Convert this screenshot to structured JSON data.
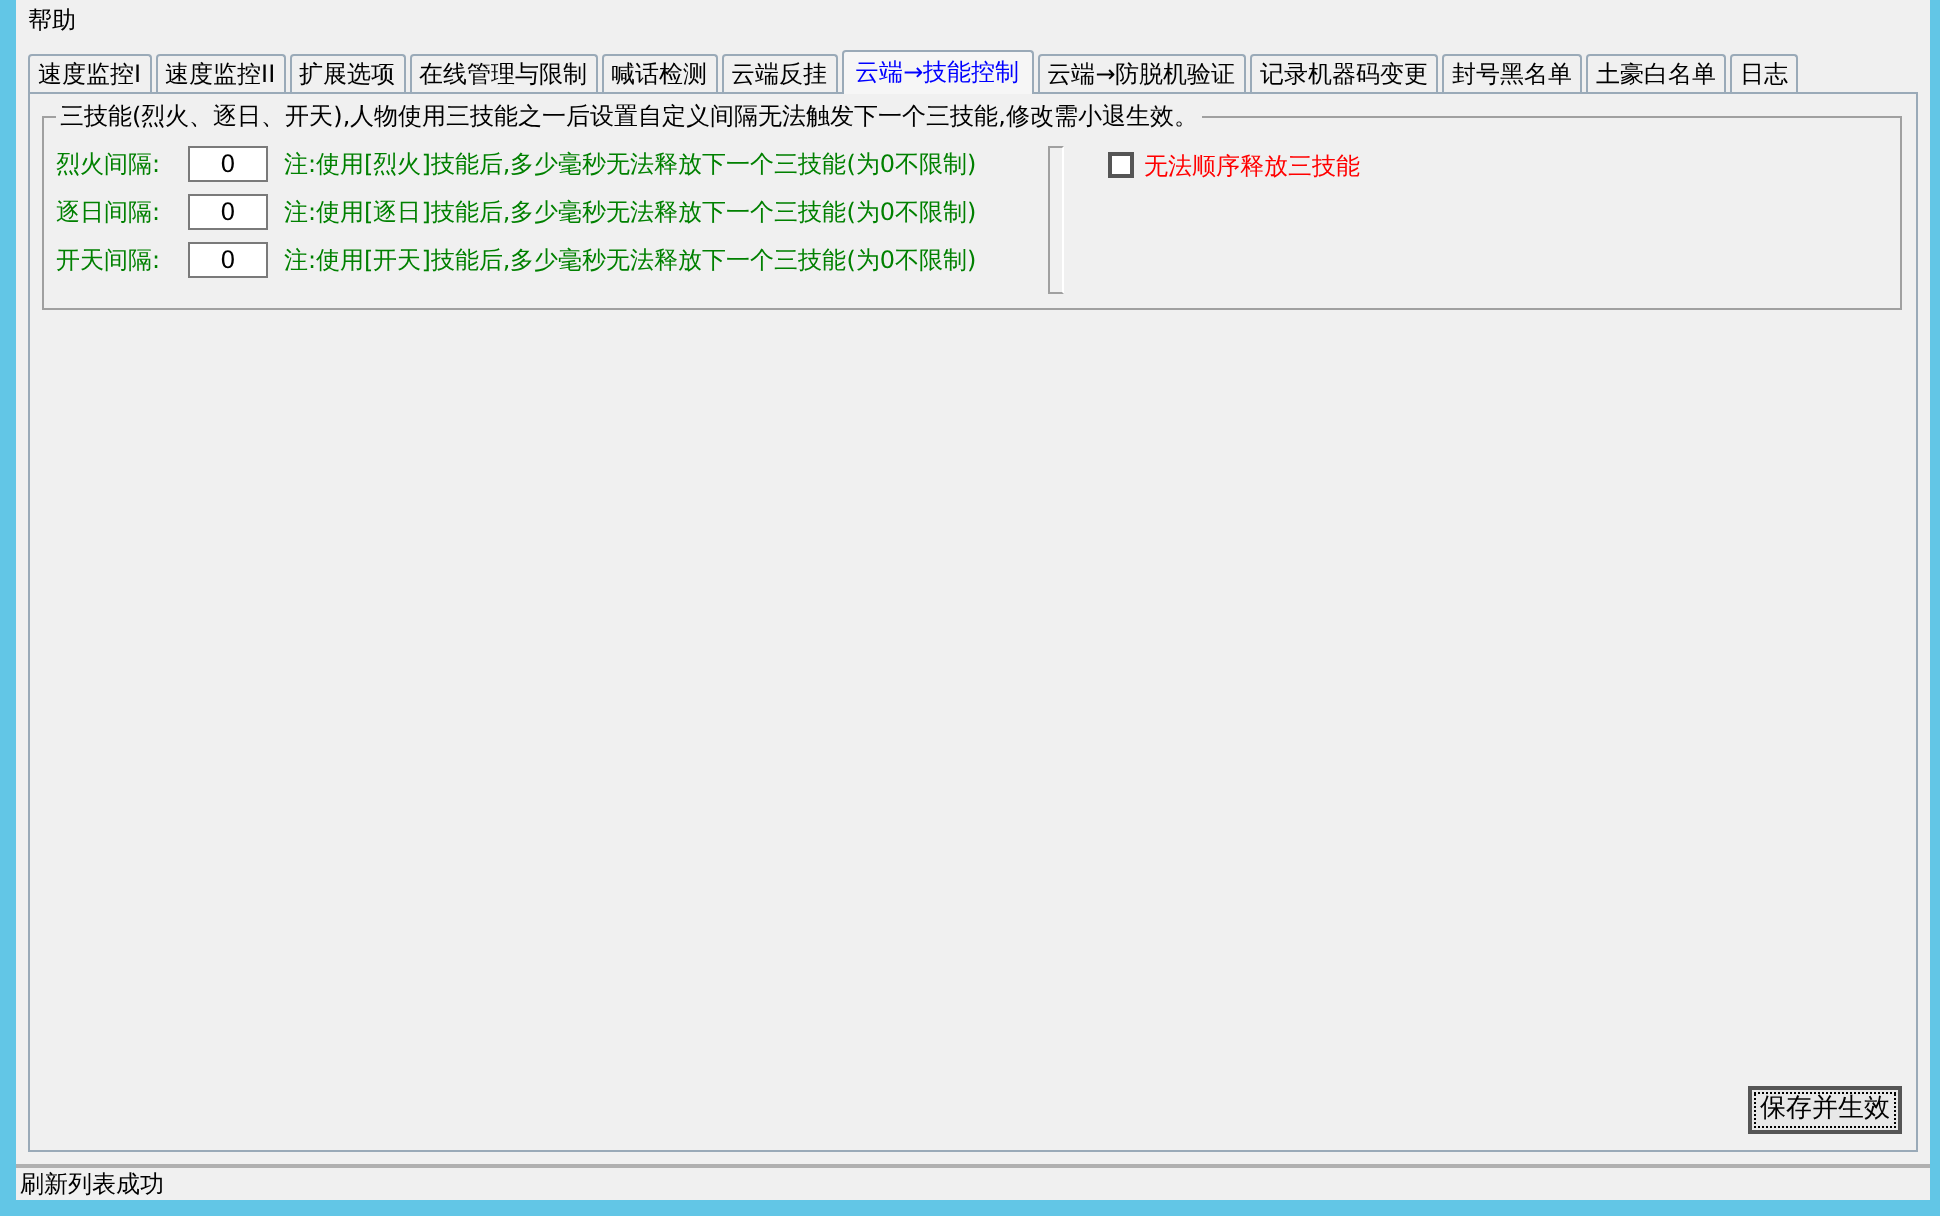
{
  "menu": [
    {
      "label": "帮助"
    }
  ],
  "tabs": [
    {
      "label": "速度监控I",
      "selected": false
    },
    {
      "label": "速度监控II",
      "selected": false
    },
    {
      "label": "扩展选项",
      "selected": false
    },
    {
      "label": "在线管理与限制",
      "selected": false
    },
    {
      "label": "喊话检测",
      "selected": false
    },
    {
      "label": "云端反挂",
      "selected": false
    },
    {
      "label": "云端→技能控制",
      "selected": true
    },
    {
      "label": "云端→防脱机验证",
      "selected": false
    },
    {
      "label": "记录机器码变更",
      "selected": false
    },
    {
      "label": "封号黑名单",
      "selected": false
    },
    {
      "label": "土豪白名单",
      "selected": false
    },
    {
      "label": "日志",
      "selected": false
    }
  ],
  "group": {
    "title": "三技能(烈火、逐日、开天),人物使用三技能之一后设置自定义间隔无法触发下一个三技能,修改需小退生效。",
    "rows": [
      {
        "label": "烈火间隔:",
        "value": "0",
        "note": "注:使用[烈火]技能后,多少毫秒无法释放下一个三技能(为0不限制)"
      },
      {
        "label": "逐日间隔:",
        "value": "0",
        "note": "注:使用[逐日]技能后,多少毫秒无法释放下一个三技能(为0不限制)"
      },
      {
        "label": "开天间隔:",
        "value": "0",
        "note": "注:使用[开天]技能后,多少毫秒无法释放下一个三技能(为0不限制)"
      }
    ],
    "checkbox": {
      "label": "无法顺序释放三技能",
      "checked": false
    }
  },
  "save_button": "保存并生效",
  "status_bar": "刷新列表成功"
}
